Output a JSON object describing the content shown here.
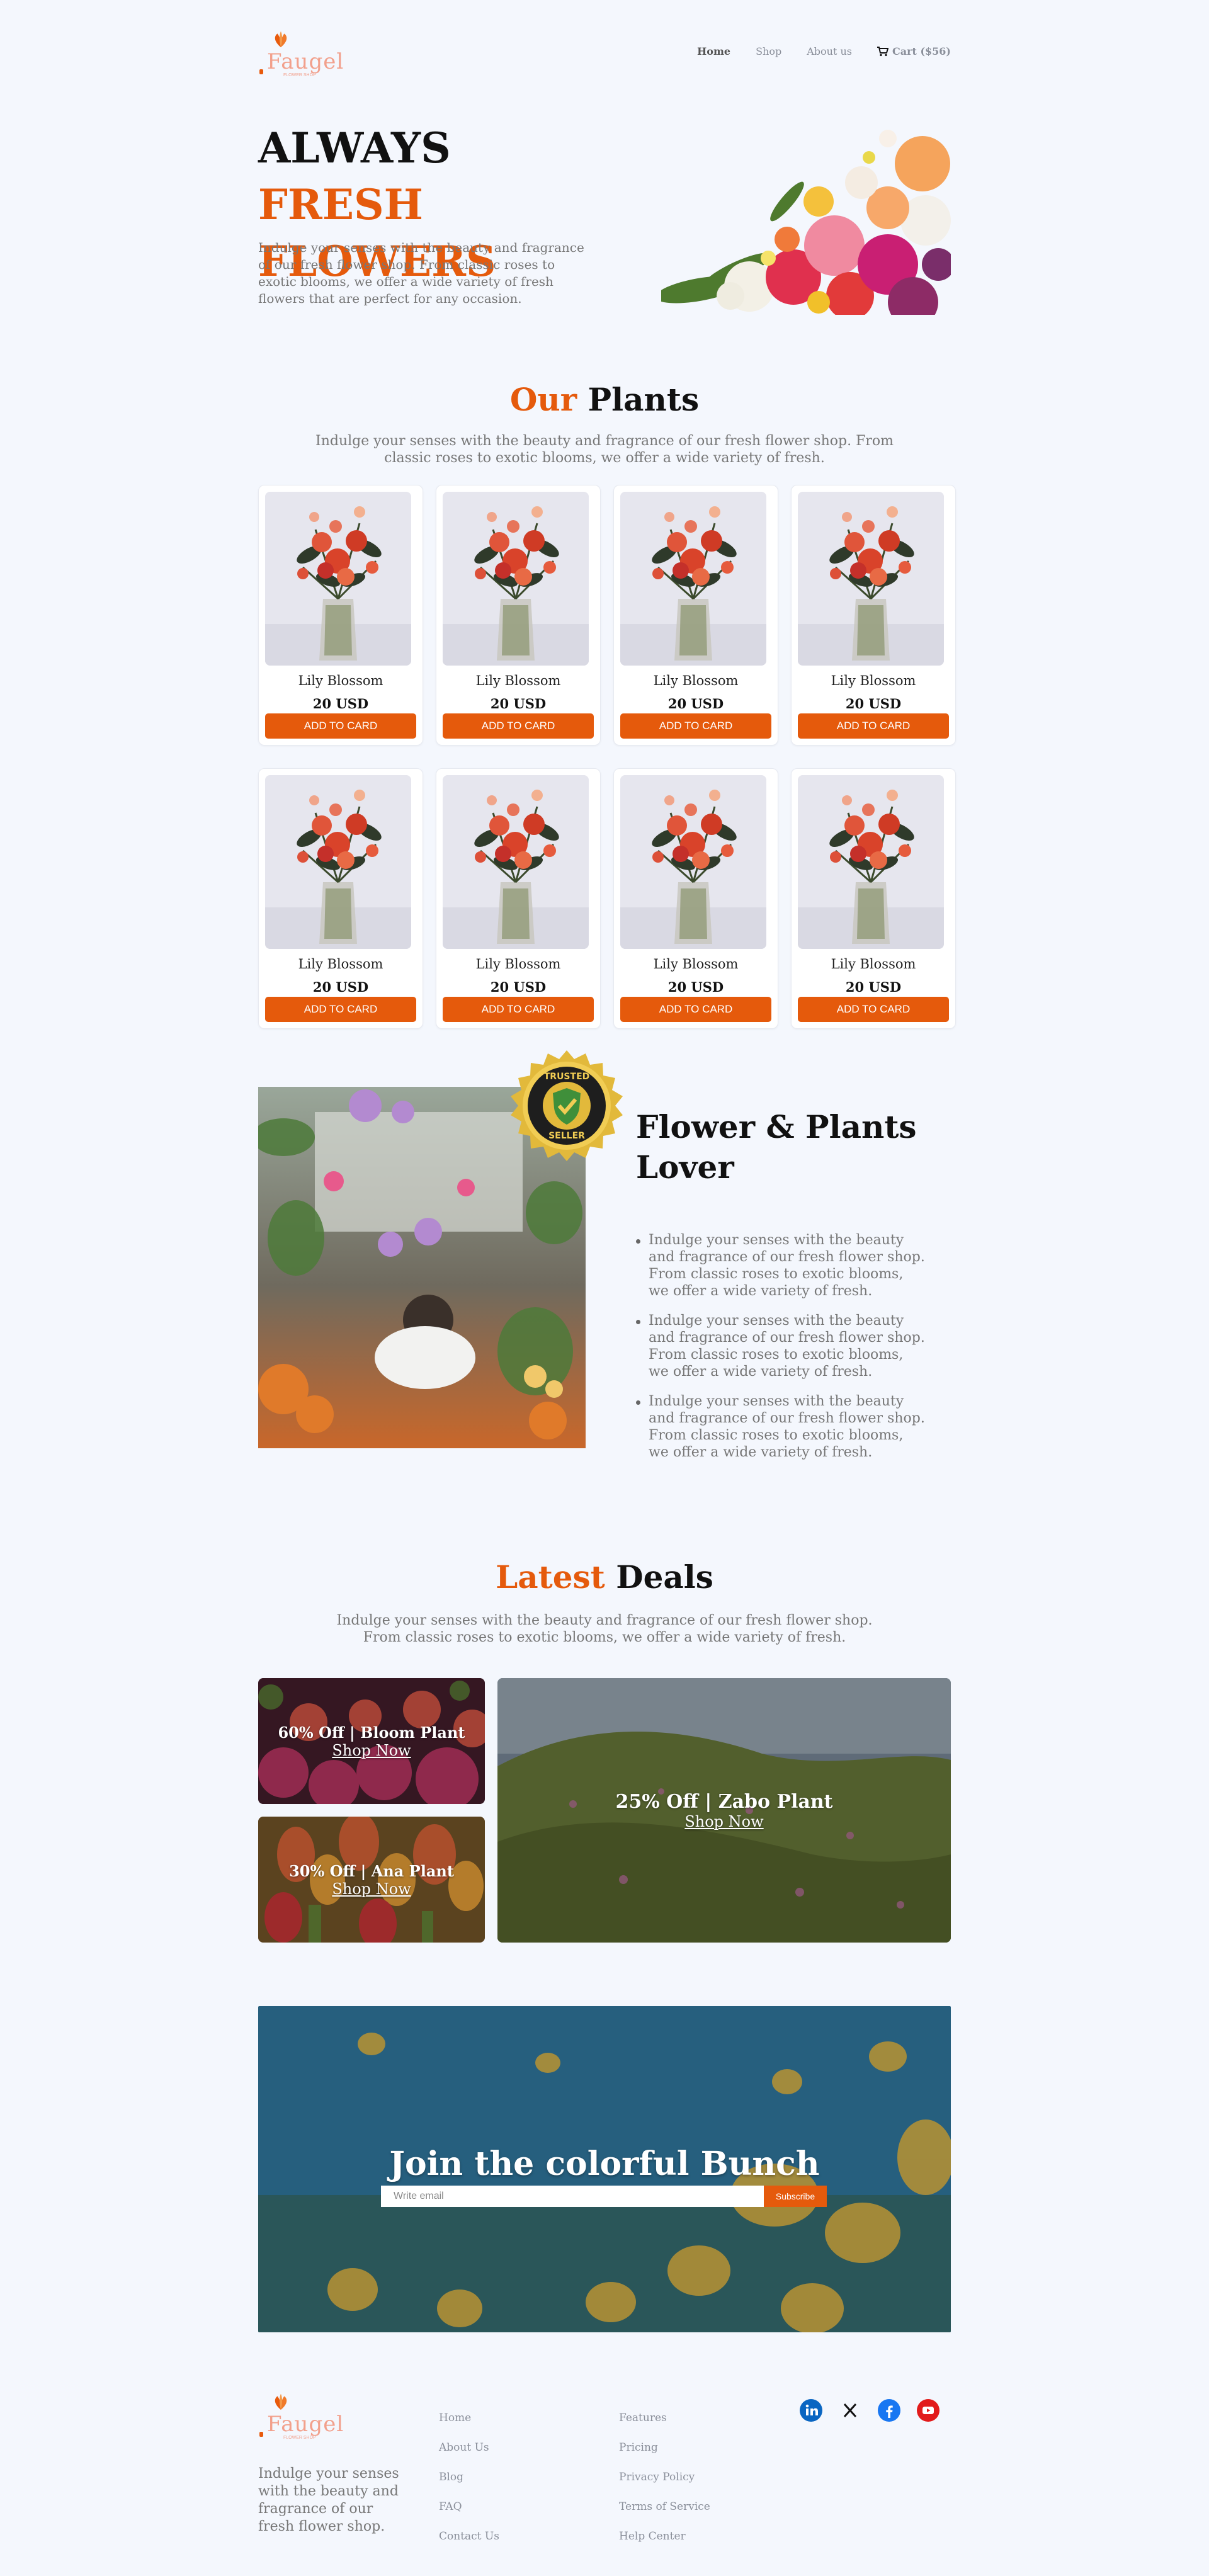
{
  "header": {
    "logo_text": "Faugel",
    "logo_sub": "FLOWER SHOP",
    "nav": [
      "Home",
      "Shop",
      "About us"
    ],
    "cart_label": "Cart ($56)"
  },
  "hero": {
    "title_a": "ALWAYS",
    "title_b": "FRESH FLOWERS",
    "description": "Indulge your senses with the beauty and fragrance of our fresh flower shop. From classic roses to exotic blooms, we offer a wide variety of fresh flowers that are perfect for any occasion."
  },
  "plants": {
    "title_a": "Our",
    "title_b": "Plants",
    "description": "Indulge your senses with the beauty and fragrance of our fresh flower shop. From classic roses to exotic blooms, we offer a wide variety of fresh.",
    "products": [
      {
        "name": "Lily Blossom",
        "price": "20 USD",
        "button": "ADD TO CARD"
      },
      {
        "name": "Lily Blossom",
        "price": "20 USD",
        "button": "ADD TO CARD"
      },
      {
        "name": "Lily Blossom",
        "price": "20 USD",
        "button": "ADD TO CARD"
      },
      {
        "name": "Lily Blossom",
        "price": "20 USD",
        "button": "ADD TO CARD"
      },
      {
        "name": "Lily Blossom",
        "price": "20 USD",
        "button": "ADD TO CARD"
      },
      {
        "name": "Lily Blossom",
        "price": "20 USD",
        "button": "ADD TO CARD"
      },
      {
        "name": "Lily Blossom",
        "price": "20 USD",
        "button": "ADD TO CARD"
      },
      {
        "name": "Lily Blossom",
        "price": "20 USD",
        "button": "ADD TO CARD"
      }
    ]
  },
  "lover": {
    "badge_top": "TRUSTED",
    "badge_bottom": "SELLER",
    "title": "Flower & Plants Lover",
    "points": [
      "Indulge your senses with the beauty and fragrance of our fresh flower shop. From classic roses to exotic blooms, we offer a wide variety of fresh.",
      "Indulge your senses with the beauty and fragrance of our fresh flower shop. From classic roses to exotic blooms, we offer a wide variety of fresh.",
      "Indulge your senses with the beauty and fragrance of our fresh flower shop. From classic roses to exotic blooms, we offer a wide variety of fresh."
    ]
  },
  "deals": {
    "title_a": "Latest",
    "title_b": "Deals",
    "description": "Indulge your senses with the beauty and fragrance of our fresh flower shop. From classic roses to exotic blooms, we offer a wide variety of fresh.",
    "items": [
      {
        "label": "60% Off | Bloom Plant",
        "link": "Shop Now"
      },
      {
        "label": "30% Off | Ana Plant",
        "link": "Shop Now"
      },
      {
        "label": "25% Off | Zabo Plant",
        "link": "Shop Now"
      }
    ]
  },
  "newsletter": {
    "title": "Join the colorful Bunch",
    "placeholder": "Write email",
    "button": "Subscribe"
  },
  "footer": {
    "description": "Indulge your senses with the beauty and fragrance of our fresh flower shop.",
    "col1": [
      "Home",
      "About Us",
      "Blog",
      "FAQ",
      "Contact Us"
    ],
    "col2": [
      "Features",
      "Pricing",
      "Privacy Policy",
      "Terms of Service",
      "Help Center"
    ],
    "social": [
      "linkedin-icon",
      "x-icon",
      "facebook-icon",
      "youtube-icon"
    ]
  },
  "colors": {
    "accent": "#e55a0c",
    "background": "#f4f7fd"
  }
}
